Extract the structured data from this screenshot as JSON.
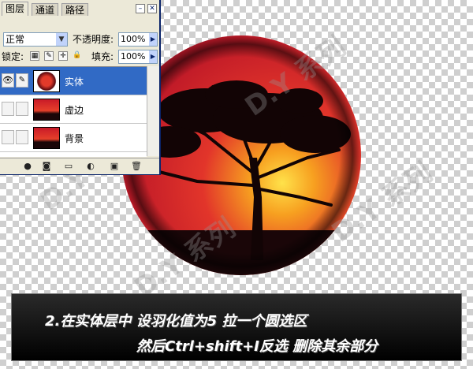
{
  "tabs": [
    {
      "label": "图层"
    },
    {
      "label": "通道"
    },
    {
      "label": "路径"
    }
  ],
  "blend_mode": "正常",
  "opacity_label": "不透明度:",
  "opacity_value": "100%",
  "lock_label": "锁定:",
  "fill_label": "填充:",
  "fill_value": "100%",
  "layers": [
    {
      "name": "实体",
      "selected": true
    },
    {
      "name": "虚边",
      "selected": false
    },
    {
      "name": "背景",
      "selected": false
    }
  ],
  "caption": {
    "line1": "2.在实体层中 设羽化值为5 拉一个圆选区",
    "line2": "然后Ctrl+shift+I反选 删除其余部分"
  },
  "colors": {
    "selection": "#316ac5",
    "panel_bg": "#ece9d8",
    "sunset_red": "#d8202a",
    "sunset_yellow": "#f5d020"
  },
  "icons": {
    "visibility": "eye-icon",
    "brush": "brush-icon",
    "lock_transparency": "checkerboard-icon",
    "lock_paint": "brush-icon",
    "lock_move": "move-icon",
    "lock_all": "padlock-icon",
    "bottom": [
      "link-icon",
      "layer-style-icon",
      "mask-icon",
      "folder-icon",
      "adjustment-icon",
      "new-layer-icon",
      "trash-icon"
    ]
  }
}
